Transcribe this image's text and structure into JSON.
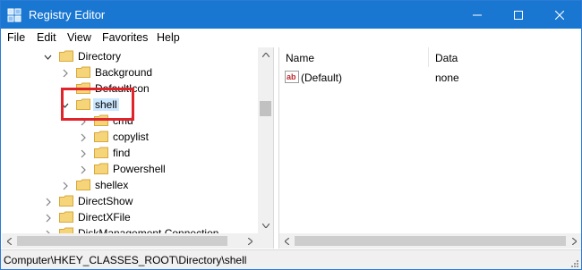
{
  "titlebar": {
    "title": "Registry Editor",
    "icons": [
      "app-registry-icon",
      "minimize-icon",
      "maximize-icon",
      "close-icon"
    ]
  },
  "menu": [
    "File",
    "Edit",
    "View",
    "Favorites",
    "Help"
  ],
  "tree": {
    "rows": [
      {
        "label": "Directory",
        "expander": "expanded",
        "level": 1
      },
      {
        "label": "Background",
        "expander": "collapsed",
        "level": 2
      },
      {
        "label": "DefaultIcon",
        "expander": "none",
        "level": 2
      },
      {
        "label": "shell",
        "expander": "expanded",
        "level": 2,
        "selected": true
      },
      {
        "label": "cmd",
        "expander": "collapsed",
        "level": 3
      },
      {
        "label": "copylist",
        "expander": "collapsed",
        "level": 3
      },
      {
        "label": "find",
        "expander": "collapsed",
        "level": 3
      },
      {
        "label": "Powershell",
        "expander": "collapsed",
        "level": 3
      },
      {
        "label": "shellex",
        "expander": "collapsed",
        "level": 2
      },
      {
        "label": "DirectShow",
        "expander": "collapsed",
        "level": 1
      },
      {
        "label": "DirectXFile",
        "expander": "collapsed",
        "level": 1
      },
      {
        "label": "DiskManagement.Connection",
        "expander": "collapsed",
        "level": 1
      }
    ]
  },
  "values": {
    "columns": {
      "name": "Name",
      "data": "Data"
    },
    "rows": [
      {
        "name": "(Default)",
        "data": "none",
        "icon": "string-value-icon"
      }
    ]
  },
  "status": {
    "path": "Computer\\HKEY_CLASSES_ROOT\\Directory\\shell"
  },
  "colors": {
    "titlebar": "#1977d2",
    "selection": "#cce8ff",
    "annotation_box": "#e0242b",
    "folder": "#f6d57a"
  }
}
